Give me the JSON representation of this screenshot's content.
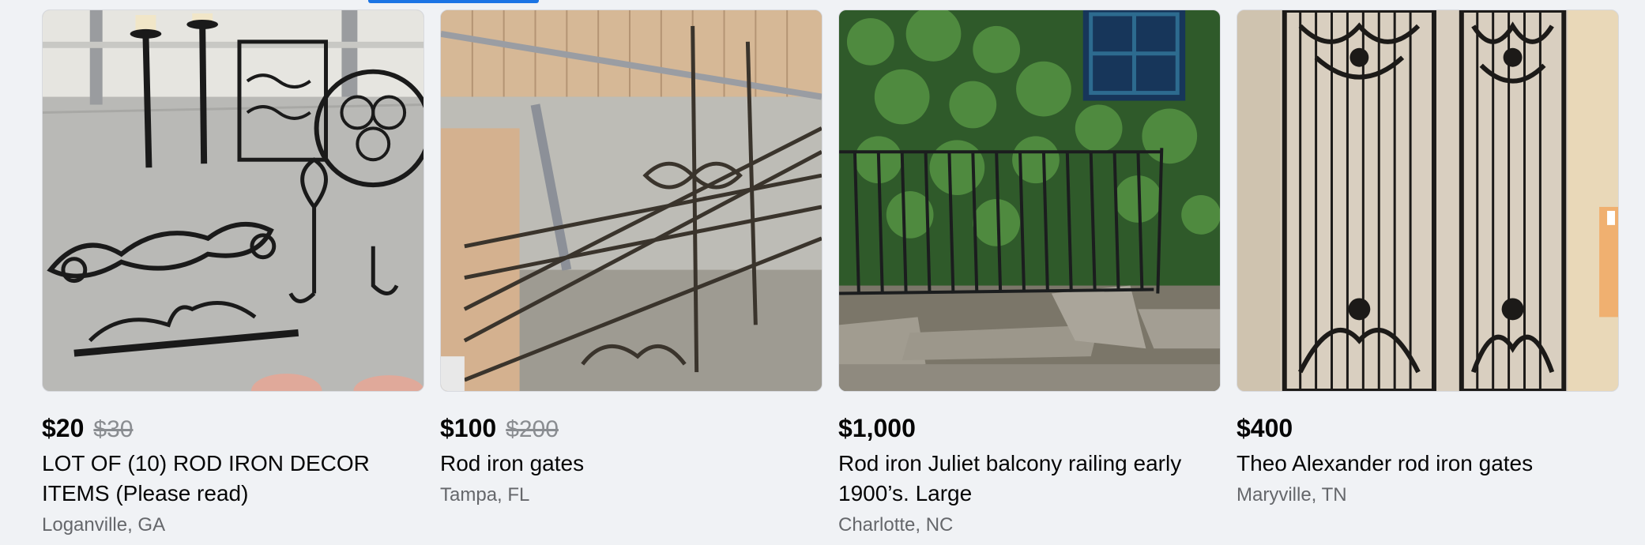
{
  "listings": [
    {
      "price": "$20",
      "old_price": "$30",
      "title": "LOT OF (10) ROD IRON DECOR ITEMS (Please read)",
      "location": "Loganville, GA",
      "image_icon": "candlesticks-wine-rack-photo"
    },
    {
      "price": "$100",
      "old_price": "$200",
      "title": "Rod iron gates",
      "location": "Tampa, FL",
      "image_icon": "iron-gate-fence-photo"
    },
    {
      "price": "$1,000",
      "old_price": "",
      "title": "Rod iron Juliet balcony railing early 1900’s. Large",
      "location": "Charlotte, NC",
      "image_icon": "balcony-railing-ivy-photo"
    },
    {
      "price": "$400",
      "old_price": "",
      "title": "Theo Alexander rod iron gates",
      "location": "Maryville, TN",
      "image_icon": "tall-iron-gates-photo"
    }
  ],
  "colors": {
    "accent": "#1b74e4",
    "price": "#050505",
    "muted": "#65676b",
    "strike": "#8a8d91"
  }
}
